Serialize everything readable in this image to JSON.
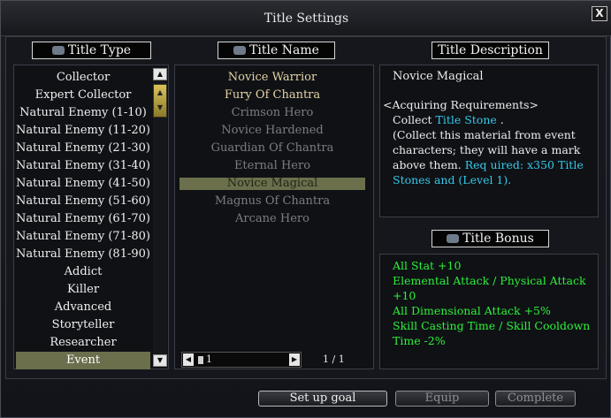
{
  "window": {
    "title": "Title Settings",
    "close_label": "X"
  },
  "headers": {
    "type": "Title Type",
    "name": "Title Name",
    "description": "Title Description",
    "bonus": "Title Bonus"
  },
  "title_types": [
    "Collector",
    "Expert Collector",
    "Natural Enemy (1-10)",
    "Natural Enemy (11-20)",
    "Natural Enemy (21-30)",
    "Natural Enemy (31-40)",
    "Natural Enemy (41-50)",
    "Natural Enemy (51-60)",
    "Natural Enemy (61-70)",
    "Natural Enemy (71-80)",
    "Natural Enemy (81-90)",
    "Addict",
    "Killer",
    "Advanced",
    "Storyteller",
    "Researcher",
    "Event"
  ],
  "selected_type": "Event",
  "title_names": [
    {
      "label": "Novice Warrior",
      "state": "available"
    },
    {
      "label": "Fury Of Chantra",
      "state": "available"
    },
    {
      "label": "Crimson Hero",
      "state": "locked"
    },
    {
      "label": "Novice Hardened",
      "state": "locked"
    },
    {
      "label": "Guardian Of Chantra",
      "state": "locked"
    },
    {
      "label": "Eternal Hero",
      "state": "locked"
    },
    {
      "label": "Novice Magical",
      "state": "selected"
    },
    {
      "label": "Magnus Of Chantra",
      "state": "locked"
    },
    {
      "label": "Arcane Hero",
      "state": "locked"
    }
  ],
  "pager": {
    "value": "1",
    "page_display": "1 / 1"
  },
  "description": {
    "title": "Novice Magical",
    "req_heading": "<Acquiring Requirements>",
    "collect_prefix": "Collect ",
    "collect_item": "Title Stone",
    "collect_suffix": " .",
    "note": "(Collect this material from event characters; they will have a mark above them.",
    "req_line": "Req uired: x350 Title Stones and (Level 1)."
  },
  "bonuses": [
    "All Stat +10",
    "Elemental Attack / Physical Attack +10",
    "All Dimensional Attack +5%",
    "Skill Casting Time / Skill Cooldown Time -2%"
  ],
  "buttons": {
    "set_goal": "Set up goal",
    "equip": "Equip",
    "complete": "Complete"
  },
  "colors": {
    "available_title": "#e4d3a3",
    "locked_title": "#7a7d82",
    "selection": "#6b6f4c",
    "bonus_text": "#2ef03a",
    "highlight": "#35c9e8"
  }
}
